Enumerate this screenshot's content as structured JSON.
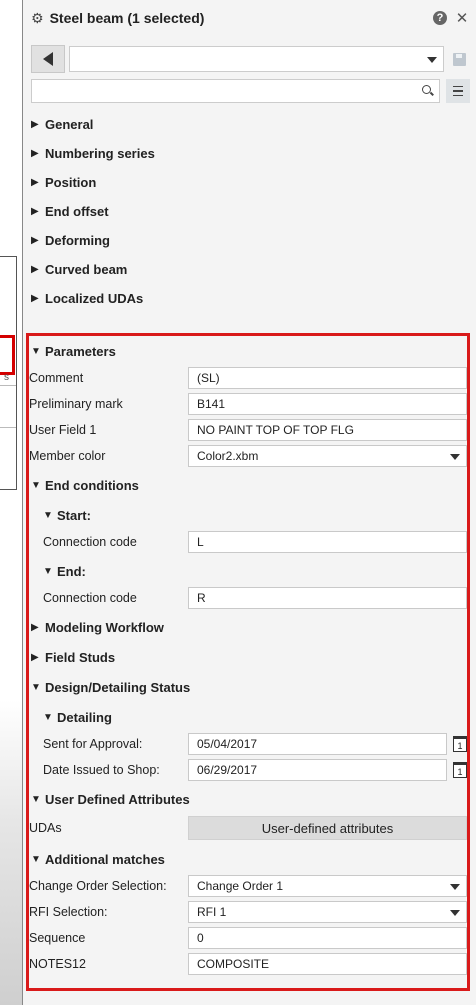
{
  "panel": {
    "title": "Steel beam (1 selected)",
    "search": {
      "placeholder": ""
    }
  },
  "groups": [
    "General",
    "Numbering series",
    "Position",
    "End offset",
    "Deforming",
    "Curved beam",
    "Localized UDAs"
  ],
  "parameters": {
    "header": "Parameters",
    "comment_label": "Comment",
    "comment_value": "(SL)",
    "prelim_label": "Preliminary mark",
    "prelim_value": "B141",
    "userfield_label": "User Field 1",
    "userfield_value": "NO PAINT TOP OF TOP FLG",
    "color_label": "Member color",
    "color_value": "Color2.xbm"
  },
  "end_conditions": {
    "header": "End conditions",
    "start_header": "Start:",
    "start_conn_label": "Connection code",
    "start_conn_value": "L",
    "end_header": "End:",
    "end_conn_label": "Connection code",
    "end_conn_value": "R"
  },
  "modeling_workflow": "Modeling Workflow",
  "field_studs": "Field Studs",
  "design_status": {
    "header": "Design/Detailing Status",
    "detailing_header": "Detailing",
    "sent_label": "Sent for Approval:",
    "sent_value": "05/04/2017",
    "issued_label": "Date Issued to Shop:",
    "issued_value": "06/29/2017",
    "cal_day": "1"
  },
  "uda": {
    "header": "User Defined Attributes",
    "label": "UDAs",
    "button": "User-defined attributes"
  },
  "additional": {
    "header": "Additional matches",
    "co_label": "Change Order Selection:",
    "co_value": "Change Order 1",
    "rfi_label": "RFI Selection:",
    "rfi_value": "RFI 1",
    "seq_label": "Sequence",
    "seq_value": "0",
    "notes_label": "NOTES12",
    "notes_value": "COMPOSITE"
  },
  "background": {
    "s_text": "s"
  },
  "colors": {
    "highlight": "#d91a1a",
    "panel_bg": "#f4f4f4"
  },
  "icons": [
    "gear-icon",
    "help-icon",
    "close-icon",
    "back-arrow-icon",
    "dropdown-caret-icon",
    "save-icon",
    "search-icon",
    "menu-icon",
    "calendar-icon"
  ]
}
